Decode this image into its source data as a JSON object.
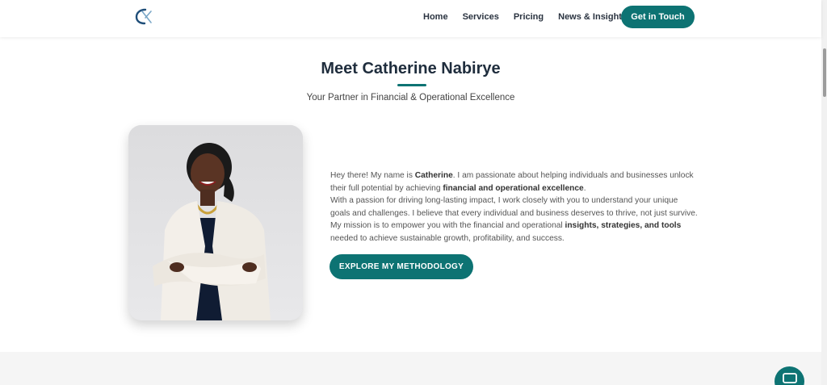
{
  "header": {
    "logo": "CN monogram logo",
    "nav": [
      "Home",
      "Services",
      "Pricing",
      "News & Insights"
    ],
    "cta": "Get in Touch"
  },
  "hero": {
    "title": "Meet Catherine Nabirye",
    "subtitle": "Your Partner in Financial & Operational Excellence",
    "bio": {
      "p1_a": "Hey there! My name is ",
      "p1_name": "Catherine",
      "p1_b": ". I am passionate about helping individuals and businesses unlock their full potential by achieving ",
      "p1_bold": "financial and operational excellence",
      "p1_c": ".",
      "p2": "With a passion for driving long-lasting impact, I work closely with you to understand your unique goals and challenges. I believe that every individual and business deserves to thrive, not just survive.",
      "p3_a": "My mission is to empower you with the financial and operational ",
      "p3_bold": "insights, strategies, and tools",
      "p3_b": " needed to achieve sustainable growth, profitability, and success."
    },
    "button": "EXPLORE MY METHODOLOGY"
  },
  "colors": {
    "accent": "#0d7373",
    "heading": "#1f2d3d"
  },
  "icons": {
    "chat": "chat-bubble-icon"
  }
}
